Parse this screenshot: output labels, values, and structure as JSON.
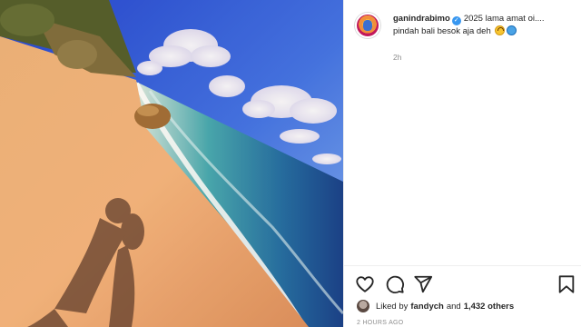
{
  "post": {
    "username": "ganindrabimo",
    "verified_icon": "verified-badge-icon",
    "caption_line1": "2025 lama amat oi....",
    "caption_line2": "pindah bali besok aja deh",
    "caption_emojis": [
      "upside-down-face",
      "water-wave"
    ],
    "time_ago": "2h",
    "liked_by_prefix": "Liked by",
    "liked_by_user": "fandych",
    "liked_by_conj": "and",
    "liked_by_others": "1,432 others",
    "posted_ago": "2 HOURS AGO"
  },
  "actions": {
    "like_icon": "heart-icon",
    "comment_icon": "comment-icon",
    "share_icon": "send-icon",
    "save_icon": "bookmark-icon"
  },
  "photo": {
    "subject": "beach-photo"
  }
}
